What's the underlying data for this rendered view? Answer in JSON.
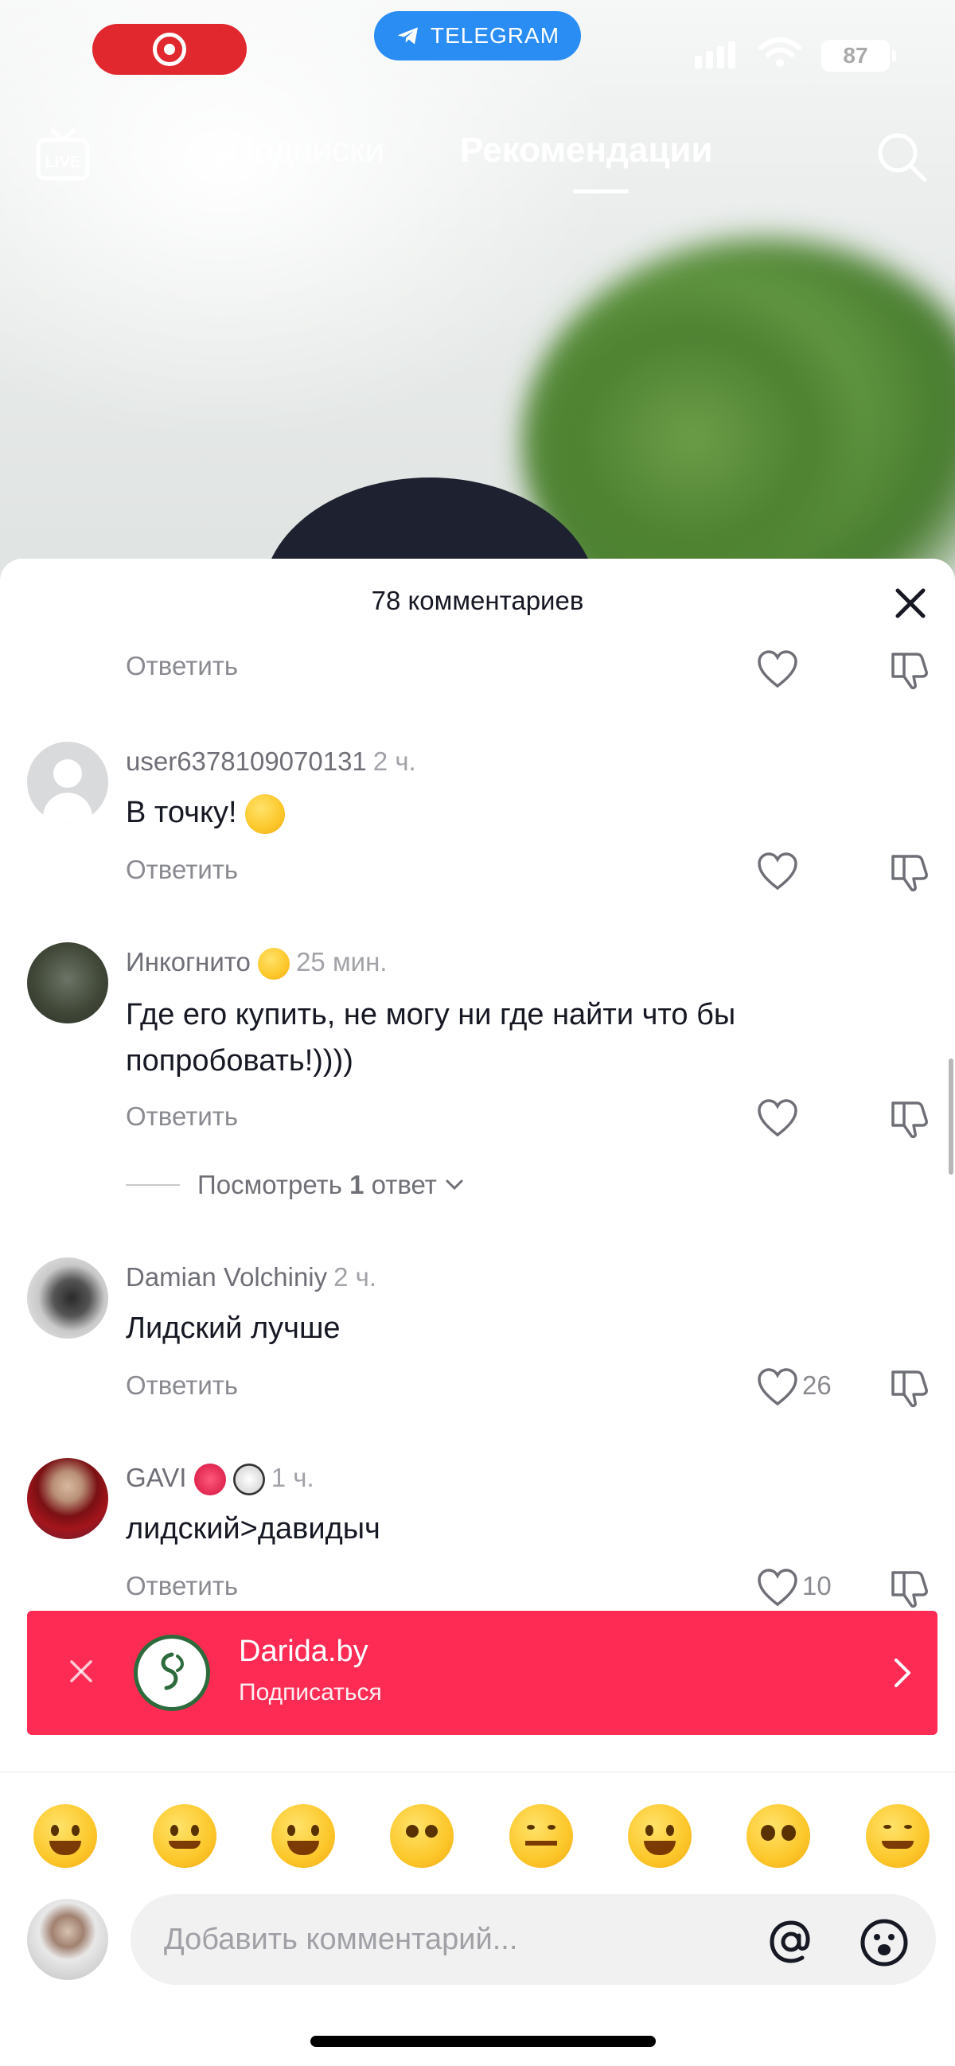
{
  "status_bar": {
    "telegram_label": "TELEGRAM",
    "battery": "87"
  },
  "top_nav": {
    "live_label": "LIVE",
    "tabs": [
      {
        "label": "Подписки"
      },
      {
        "label": "Рекомендации"
      }
    ]
  },
  "comments": {
    "title": "78 комментариев",
    "reply_label": "Ответить",
    "view_replies": {
      "prefix": "Посмотреть ",
      "count": "1",
      "suffix": " ответ"
    },
    "items": [
      {
        "user": "user6378109070131",
        "time": "2 ч.",
        "text": "В точку!",
        "likes": ""
      },
      {
        "user": "Инкогнито",
        "time": "25 мин.",
        "text": "Где его купить, не могу ни где найти что бы попробовать!))))",
        "likes": ""
      },
      {
        "user": "Damian Volchiniy",
        "time": "2 ч.",
        "text": "Лидский лучше",
        "likes": "26"
      },
      {
        "user": "GAVI",
        "time": "1 ч.",
        "text": "лидский>давидыч",
        "likes": "10"
      }
    ]
  },
  "ad": {
    "name": "Darida.by",
    "action": "Подписаться"
  },
  "emoji_bar": [
    "grinning",
    "smiling-hearts",
    "tears-of-joy",
    "flushed",
    "smirk",
    "sweat-smile",
    "pleading",
    "relieved"
  ],
  "input": {
    "placeholder": "Добавить комментарий..."
  },
  "colors": {
    "ad_background": "#fe2c55",
    "recording_pill": "#e0282e",
    "telegram_pill": "#2a8df4"
  }
}
